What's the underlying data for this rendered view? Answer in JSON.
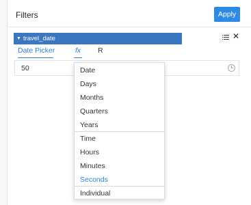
{
  "header": {
    "title": "Filters",
    "apply_label": "Apply"
  },
  "filter": {
    "name": "travel_date"
  },
  "tabs": [
    {
      "label": "Date Picker"
    },
    {
      "label": "fx"
    },
    {
      "label": "R"
    }
  ],
  "input": {
    "value": "50"
  },
  "dropdown": {
    "options": [
      "Date",
      "Days",
      "Months",
      "Quarters",
      "Years",
      "Time",
      "Hours",
      "Minutes",
      "Seconds",
      "Individual"
    ],
    "selected": "Seconds"
  },
  "colors": {
    "accent": "#2d7fd3",
    "chip": "#3b76c0",
    "apply": "#2d8be3"
  }
}
